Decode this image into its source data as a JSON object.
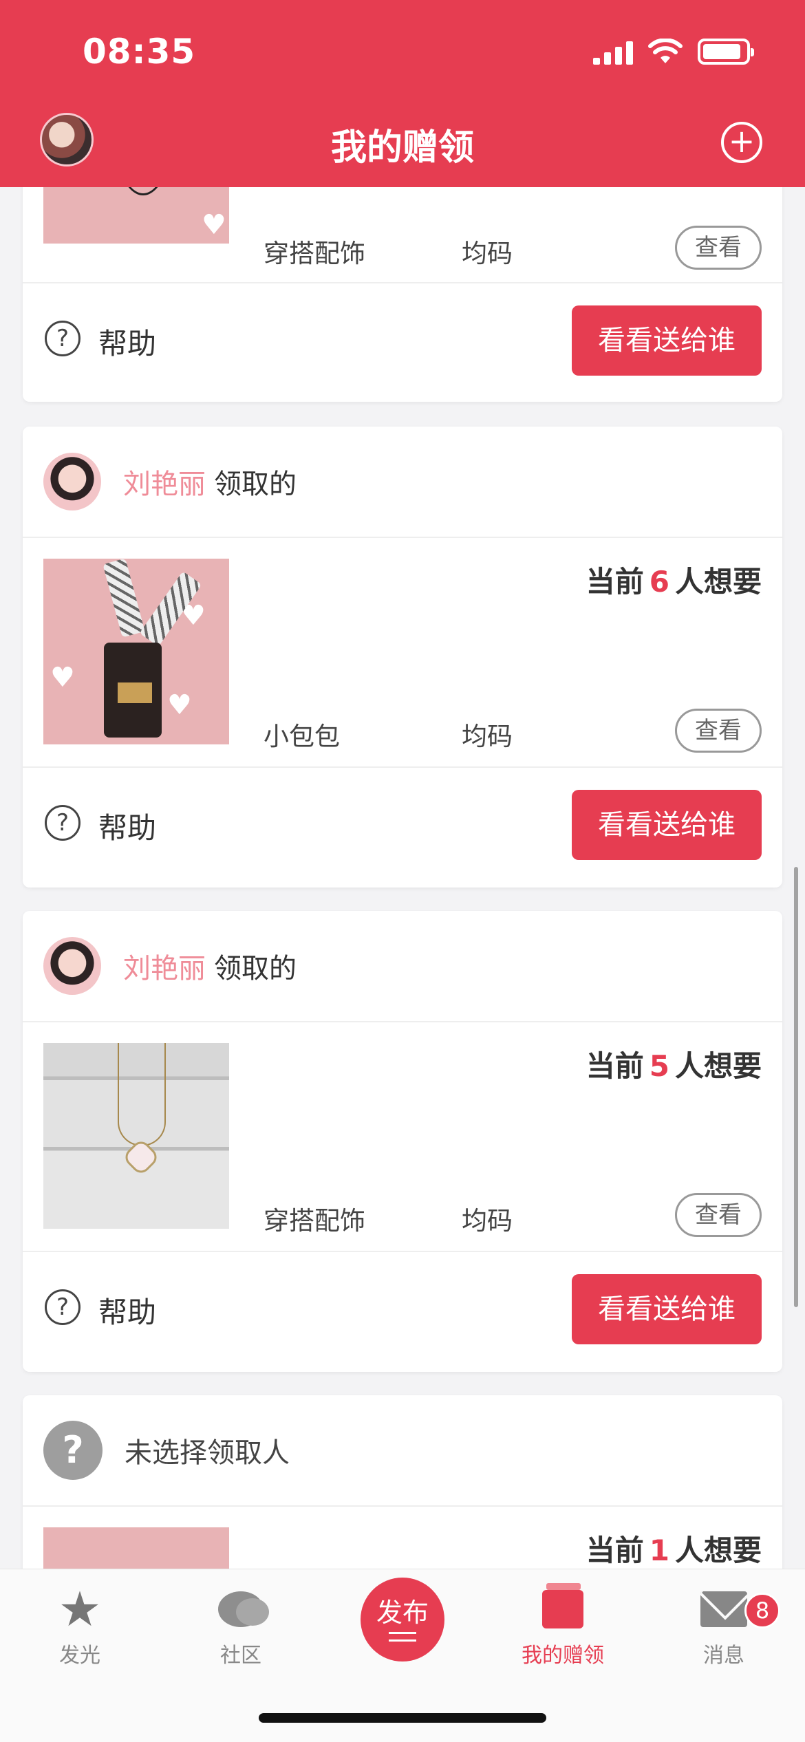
{
  "status_bar": {
    "time": "08:35"
  },
  "header": {
    "title": "我的赠领"
  },
  "cards": [
    {
      "category": "穿搭配饰",
      "size": "均码",
      "view_label": "查看",
      "help_label": "帮助",
      "send_label": "看看送给谁"
    },
    {
      "receiver_name": "刘艳丽",
      "claim_text": "领取的",
      "want_prefix": "当前",
      "want_count": "6",
      "want_suffix": "人想要",
      "category": "小包包",
      "size": "均码",
      "view_label": "查看",
      "help_label": "帮助",
      "send_label": "看看送给谁"
    },
    {
      "receiver_name": "刘艳丽",
      "claim_text": "领取的",
      "want_prefix": "当前",
      "want_count": "5",
      "want_suffix": "人想要",
      "category": "穿搭配饰",
      "size": "均码",
      "view_label": "查看",
      "help_label": "帮助",
      "send_label": "看看送给谁"
    },
    {
      "no_receiver_text": "未选择领取人",
      "want_prefix": "当前",
      "want_count": "1",
      "want_suffix": "人想要"
    }
  ],
  "tabbar": {
    "items": [
      {
        "label": "发光",
        "icon": "star-icon"
      },
      {
        "label": "社区",
        "icon": "chat-bubbles-icon"
      },
      {
        "label": "发布",
        "icon": "publish-icon"
      },
      {
        "label": "我的赠领",
        "icon": "gift-box-icon",
        "active": true
      },
      {
        "label": "消息",
        "icon": "mail-icon",
        "badge": "8"
      }
    ]
  },
  "colors": {
    "brand": "#e63d51",
    "name": "#ef8c98"
  }
}
